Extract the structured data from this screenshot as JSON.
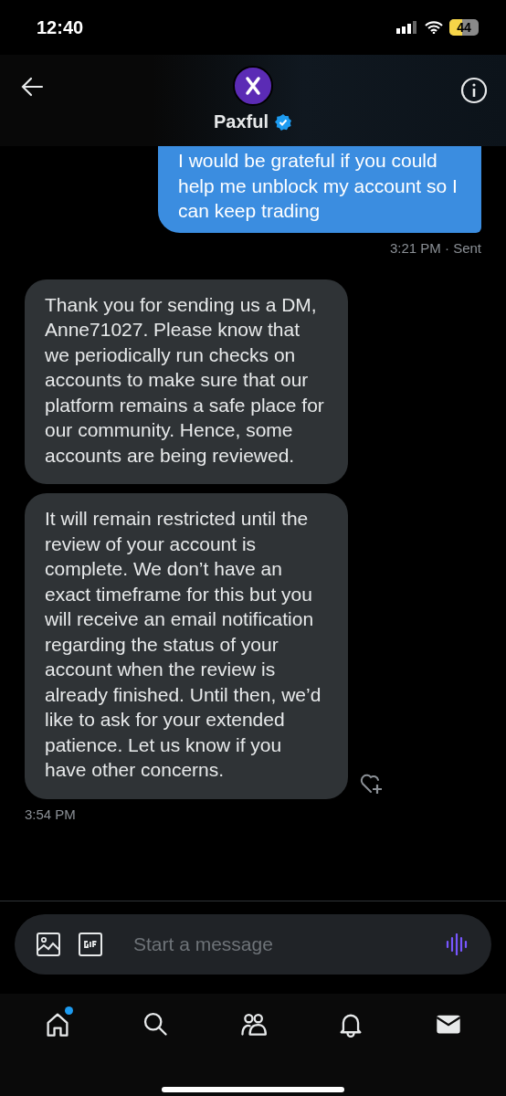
{
  "status_bar": {
    "time": "12:40",
    "battery": "44"
  },
  "header": {
    "name": "Paxful"
  },
  "messages": [
    {
      "kind": "sent",
      "text": "I would be grateful if you could help me unblock my account so I can keep trading",
      "reaction_button": false,
      "meta": "3:21 PM · Sent"
    },
    {
      "kind": "received",
      "text": "Thank you for sending us a DM, Anne71027. Please know that we periodically run checks on accounts to make sure that our platform remains a safe place for our community. Hence, some accounts are being reviewed.",
      "reaction_button": false
    },
    {
      "kind": "received",
      "text": "It will remain restricted until the review of your account is complete. We don’t have an exact timeframe for this but you will receive an email notification regarding the status of your account when the review is already finished. Until then, we’d like to ask for your extended patience. Let us know if you have other concerns.",
      "reaction_button": true,
      "meta": "3:54 PM"
    }
  ],
  "composer": {
    "placeholder": "Start a message"
  },
  "nav": [
    {
      "kind": "home",
      "selected": false,
      "dot": true
    },
    {
      "kind": "search",
      "selected": false,
      "dot": false
    },
    {
      "kind": "communities",
      "selected": false,
      "dot": false
    },
    {
      "kind": "notifications",
      "selected": false,
      "dot": false
    },
    {
      "kind": "messages",
      "selected": true,
      "dot": false
    }
  ]
}
